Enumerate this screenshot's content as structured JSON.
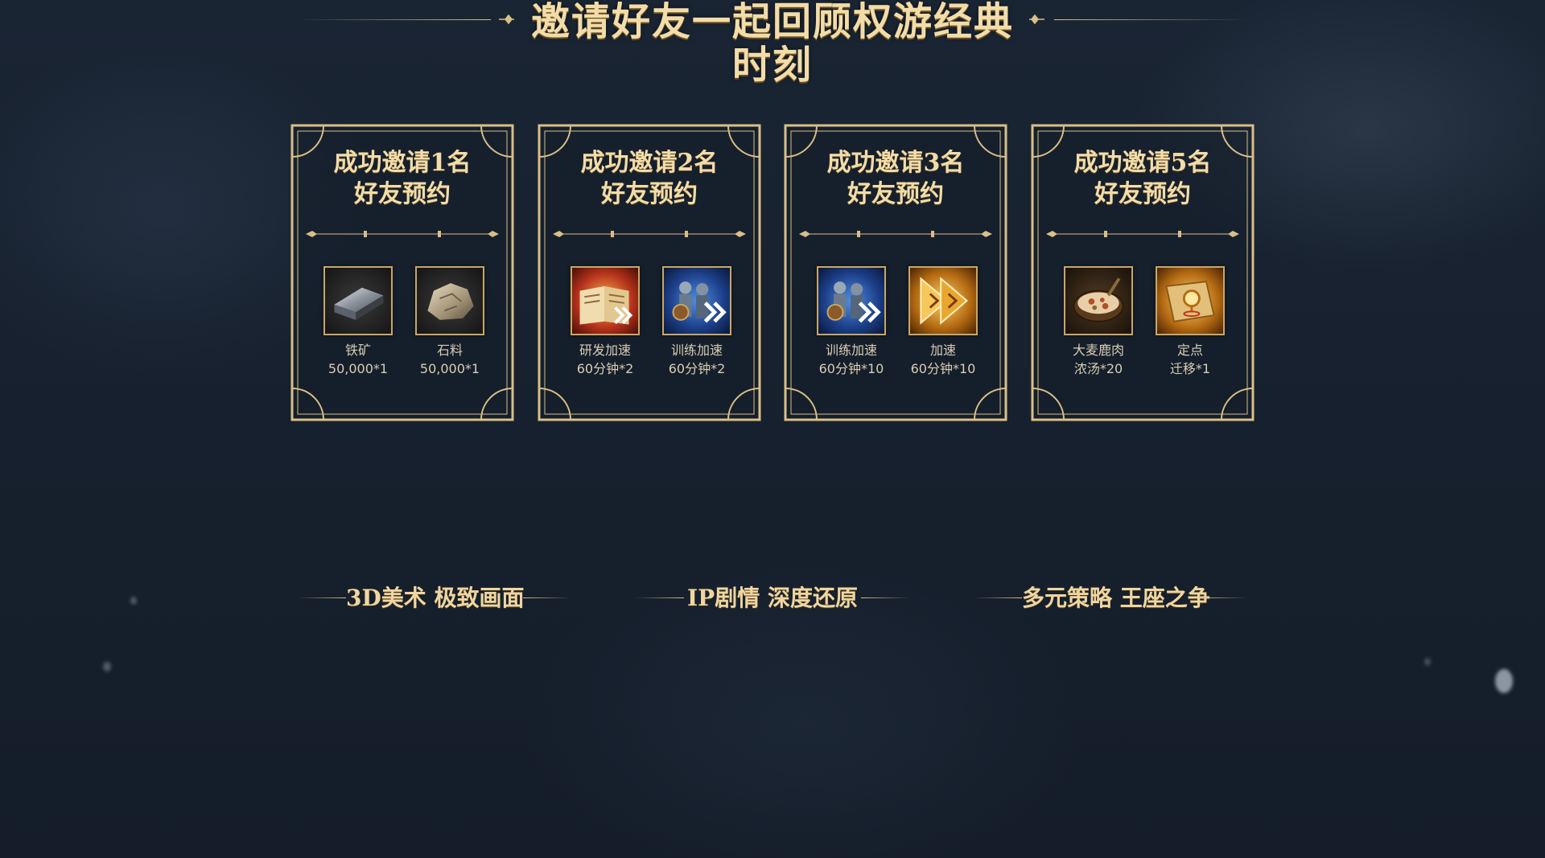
{
  "header": {
    "title": "邀请好友一起回顾权游经典时刻"
  },
  "cards": [
    {
      "title_line1": "成功邀请1名",
      "title_line2": "好友预约",
      "rewards": [
        {
          "name": "铁矿",
          "qty": "50,000*1",
          "icon": "iron-ingot-icon"
        },
        {
          "name": "石料",
          "qty": "50,000*1",
          "icon": "stone-icon"
        }
      ]
    },
    {
      "title_line1": "成功邀请2名",
      "title_line2": "好友预约",
      "rewards": [
        {
          "name": "研发加速",
          "qty": "60分钟*2",
          "icon": "research-speedup-book-icon"
        },
        {
          "name": "训练加速",
          "qty": "60分钟*2",
          "icon": "training-speedup-soldiers-icon"
        }
      ]
    },
    {
      "title_line1": "成功邀请3名",
      "title_line2": "好友预约",
      "rewards": [
        {
          "name": "训练加速",
          "qty": "60分钟*10",
          "icon": "training-speedup-soldiers-icon"
        },
        {
          "name": "加速",
          "qty": "60分钟*10",
          "icon": "speedup-arrows-icon"
        }
      ]
    },
    {
      "title_line1": "成功邀请5名",
      "title_line2": "好友预约",
      "rewards": [
        {
          "name": "大麦鹿肉",
          "qty": "浓汤*20",
          "icon": "venison-stew-bowl-icon"
        },
        {
          "name": "定点",
          "qty": "迁移*1",
          "icon": "teleport-map-scroll-icon"
        }
      ]
    }
  ],
  "features": [
    {
      "label": "3D美术 极致画面"
    },
    {
      "label": "IP剧情 深度还原"
    },
    {
      "label": "多元策略 王座之争"
    }
  ],
  "colors": {
    "gold": "#d9bf87",
    "title_gold": "#f2dca8",
    "background": "#17212f"
  }
}
